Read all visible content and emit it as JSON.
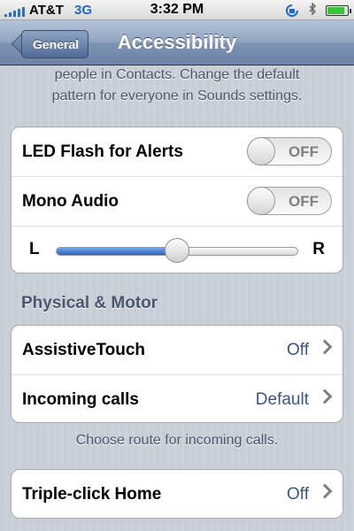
{
  "statusbar": {
    "carrier": "AT&T",
    "network": "3G",
    "time": "3:32 PM",
    "icons": [
      "signal-bars",
      "rotation-lock-icon",
      "bluetooth-icon",
      "battery-icon"
    ]
  },
  "nav": {
    "back_label": "General",
    "title": "Accessibility"
  },
  "top_footer": {
    "line1": "people in Contacts. Change the default",
    "line2": "pattern for everyone in Sounds settings."
  },
  "audio_group": {
    "led_flash": {
      "label": "LED Flash for Alerts",
      "state": "OFF"
    },
    "mono_audio": {
      "label": "Mono Audio",
      "state": "OFF"
    },
    "balance": {
      "left": "L",
      "right": "R",
      "value_fraction": 0.5
    }
  },
  "physical_motor": {
    "header": "Physical & Motor",
    "assistive_touch": {
      "label": "AssistiveTouch",
      "value": "Off"
    },
    "incoming_calls": {
      "label": "Incoming calls",
      "value": "Default"
    },
    "footer": "Choose route for incoming calls."
  },
  "triple_click": {
    "label": "Triple-click Home",
    "value": "Off"
  },
  "colors": {
    "value_blue": "#385487",
    "slider_blue": "#2c63c2",
    "battery_green": "#3bc43b"
  }
}
